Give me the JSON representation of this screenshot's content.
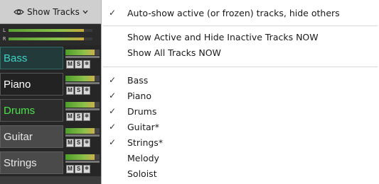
{
  "toolbar": {
    "show_tracks_label": "Show Tracks"
  },
  "master_meter": {
    "left_label": "L",
    "right_label": "R"
  },
  "tracks": [
    {
      "name": "Bass",
      "name_color": "#3fd3c7",
      "mute": "M",
      "solo": "S"
    },
    {
      "name": "Piano",
      "name_color": "#ffffff",
      "mute": "M",
      "solo": "S"
    },
    {
      "name": "Drums",
      "name_color": "#4be24b",
      "mute": "M",
      "solo": "S"
    },
    {
      "name": "Guitar",
      "name_color": "#e6e6e6",
      "mute": "M",
      "solo": "S"
    },
    {
      "name": "Strings",
      "name_color": "#e6e6e6",
      "mute": "M",
      "solo": "S"
    }
  ],
  "menu": {
    "auto_show": {
      "label": "Auto-show active (or frozen) tracks, hide others",
      "checked": true
    },
    "show_active_hide_inactive": {
      "label": "Show Active and Hide Inactive Tracks NOW"
    },
    "show_all": {
      "label": "Show All Tracks NOW"
    },
    "track_items": [
      {
        "label": "Bass",
        "checked": true
      },
      {
        "label": "Piano",
        "checked": true
      },
      {
        "label": "Drums",
        "checked": true
      },
      {
        "label": "Guitar*",
        "checked": true
      },
      {
        "label": "Strings*",
        "checked": true
      },
      {
        "label": "Melody",
        "checked": false
      },
      {
        "label": "Soloist",
        "checked": false
      }
    ],
    "check_glyph": "✓"
  },
  "icons": {
    "eye": "eye-icon",
    "chevron": "chevron-down-icon",
    "check": "checkmark-icon"
  }
}
